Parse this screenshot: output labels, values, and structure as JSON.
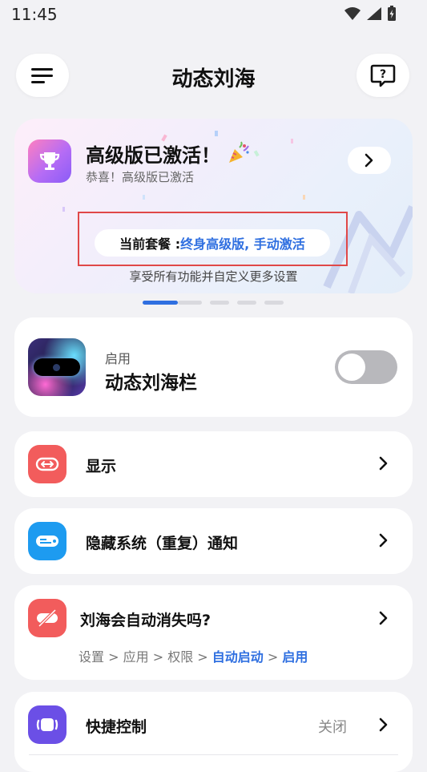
{
  "status": {
    "time": "11:45"
  },
  "header": {
    "title": "动态刘海",
    "menu_icon": "menu-icon",
    "help_icon": "help-icon"
  },
  "banner": {
    "title": "高级版已激活！",
    "subtitle": "恭喜！高级版已激活",
    "plan_label": "当前套餐 : ",
    "plan_value": "终身高级版, 手动激活",
    "footer": "享受所有功能并自定义更多设置",
    "icon": "trophy-icon"
  },
  "notch": {
    "small_label": "启用",
    "title": "动态刘海栏",
    "toggle_on": false
  },
  "rows": {
    "display": {
      "label": "显示",
      "color": "#f25c5c"
    },
    "hide": {
      "label": "隐藏系统（重复）通知",
      "color": "#1d9bf0"
    },
    "autohide": {
      "label": "刘海会自动消失吗?",
      "color": "#f25c5c",
      "crumbs": [
        "设置",
        "应用",
        "权限"
      ],
      "crumb_sep": " > ",
      "crumb_hl1": "自动启动",
      "crumb_hl2": "启用"
    },
    "quick": {
      "label": "快捷控制",
      "state": "关闭",
      "color": "#6b4fe6"
    }
  },
  "colors": {
    "accent": "#2f6fe0",
    "highlight_box": "#e04848"
  }
}
